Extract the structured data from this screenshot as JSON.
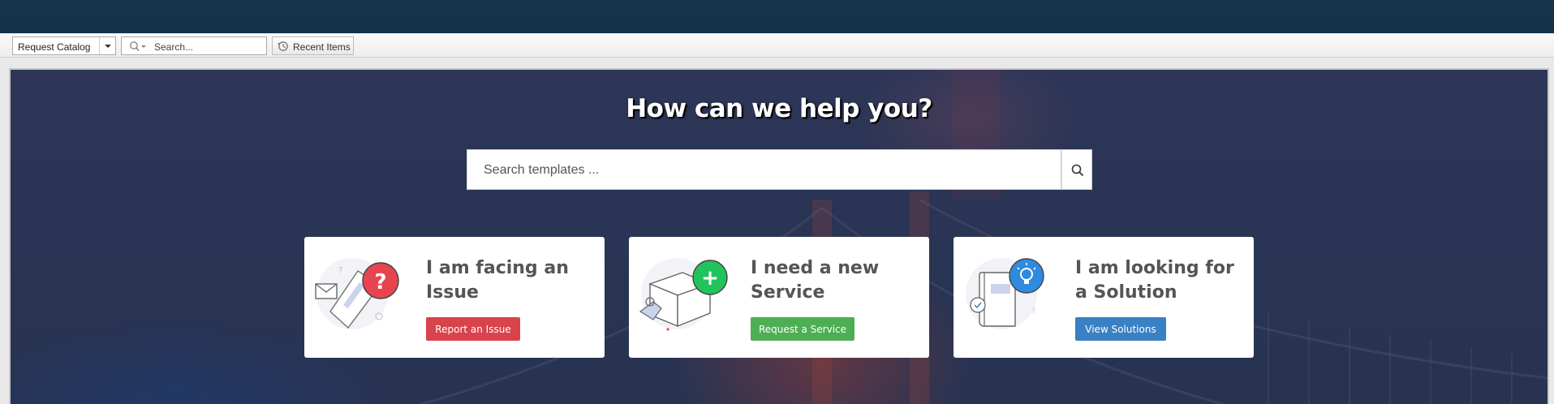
{
  "toolbar": {
    "module_select": "Request Catalog",
    "search_placeholder": "Search...",
    "recent_items": "Recent Items"
  },
  "hero": {
    "headline": "How can we help you?",
    "search_placeholder": "Search templates ..."
  },
  "cards": [
    {
      "title": "I am facing an Issue",
      "button": "Report an Issue",
      "badge_icon": "question-icon",
      "color": "#d9434b"
    },
    {
      "title": "I need a new Service",
      "button": "Request a Service",
      "badge_icon": "plus-icon",
      "color": "#4eae53"
    },
    {
      "title": "I am looking for a Solution",
      "button": "View Solutions",
      "badge_icon": "lightbulb-icon",
      "color": "#3a80c4"
    }
  ]
}
